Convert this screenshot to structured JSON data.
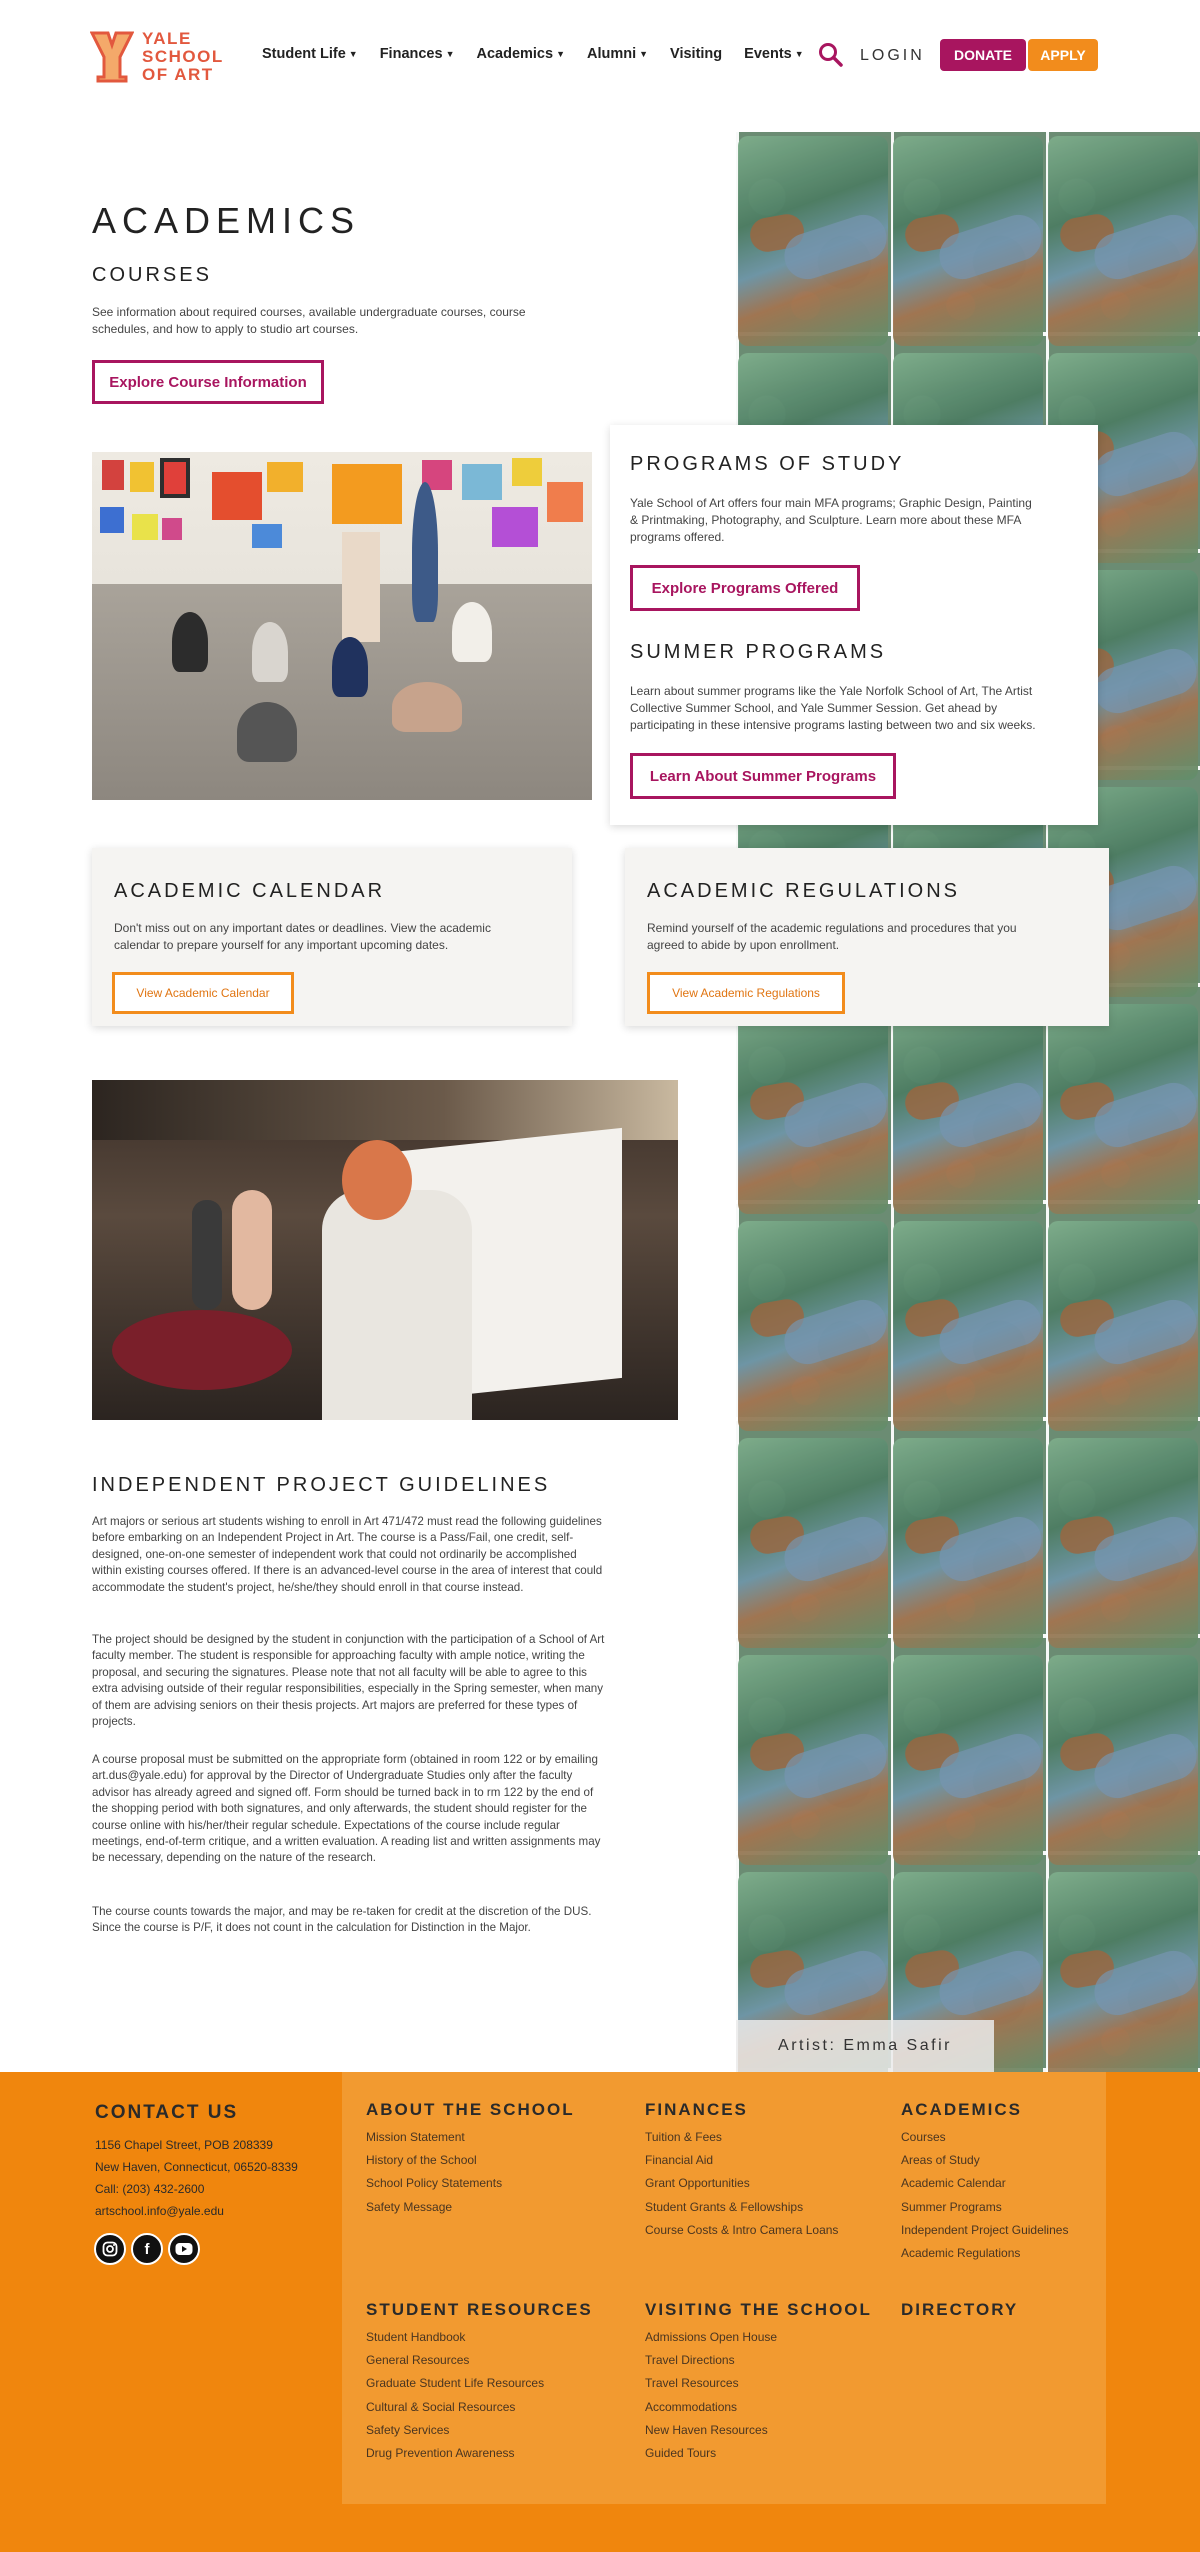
{
  "header": {
    "logo_text": [
      "YALE",
      "SCHOOL",
      "OF ART"
    ],
    "nav": [
      {
        "label": "Student Life",
        "dropdown": true
      },
      {
        "label": "Finances",
        "dropdown": true
      },
      {
        "label": "Academics",
        "dropdown": true
      },
      {
        "label": "Alumni",
        "dropdown": true
      },
      {
        "label": "Visiting",
        "dropdown": false
      },
      {
        "label": "Events",
        "dropdown": true
      }
    ],
    "login_label": "LOGIN",
    "donate_label": "DONATE",
    "apply_label": "APPLY"
  },
  "page": {
    "title": "ACADEMICS",
    "courses": {
      "heading": "COURSES",
      "text": "See information about required courses, available undergraduate courses, course schedules, and how to apply to studio art courses.",
      "button": "Explore Course Information"
    },
    "programs": {
      "heading": "PROGRAMS OF STUDY",
      "text": "Yale School of Art offers four main MFA programs; Graphic Design, Painting & Printmaking, Photography, and Sculpture. Learn more about these MFA programs offered.",
      "button": "Explore Programs Offered"
    },
    "summer": {
      "heading": "SUMMER PROGRAMS",
      "text": "Learn about summer programs like the Yale Norfolk School of Art, The Artist Collective Summer School, and Yale Summer Session. Get ahead by participating in these intensive programs lasting between two and six weeks.",
      "button": "Learn About Summer Programs"
    },
    "calendar": {
      "heading": "ACADEMIC CALENDAR",
      "text": "Don't miss out on any important dates or deadlines. View the academic calendar to prepare yourself for any important upcoming dates.",
      "button": "View Academic Calendar"
    },
    "regulations": {
      "heading": "ACADEMIC REGULATIONS",
      "text": "Remind yourself of the academic regulations and procedures that you agreed to abide by upon enrollment.",
      "button": "View Academic Regulations"
    },
    "ipg": {
      "heading": "INDEPENDENT PROJECT GUIDELINES",
      "paragraphs": [
        "Art majors or serious art students wishing to enroll in Art 471/472 must read the following guidelines before embarking on an Independent Project in Art. The course is a Pass/Fail, one credit, self-designed, one-on-one semester of independent work that could not ordinarily be accomplished within existing courses offered. If there is an advanced-level course in the area of interest that could accommodate the student's project, he/she/they should enroll in that course instead.",
        "The project should be designed by the student in conjunction with the participation of a School of Art faculty member. The student is responsible for approaching faculty with ample notice, writing the proposal, and securing the signatures. Please note that not all faculty will be able to agree to this extra advising outside of their regular responsibilities, especially in the Spring semester, when many of them are advising seniors on their thesis projects. Art majors are preferred for these types of projects.",
        "A course proposal must be submitted on the appropriate form (obtained in room 122 or by emailing art.dus@yale.edu) for approval by the Director of Undergraduate Studies only after the faculty advisor has already agreed and signed off. Form should be turned back in to rm 122 by the end of the shopping period with both signatures, and only afterwards, the student should register for the course online with his/her/their regular schedule. Expectations of the course include regular meetings, end-of-term critique, and a written evaluation. A reading list and written assignments may be necessary, depending on the nature of the research.",
        "The course counts towards the major, and may be re-taken for credit at the discretion of the DUS. Since the course is P/F, it does not count in the calculation for Distinction in the Major."
      ]
    },
    "artist_caption": "Artist: Emma Safir"
  },
  "footer": {
    "contact": {
      "heading": "CONTACT US",
      "address1": "1156 Chapel Street, POB 208339",
      "address2": "New Haven, Connecticut, 06520-8339",
      "phone": "Call: (203) 432-2600",
      "email": "artschool.info@yale.edu",
      "social": [
        "instagram-icon",
        "facebook-icon",
        "youtube-icon"
      ]
    },
    "about": {
      "heading": "ABOUT THE SCHOOL",
      "links": [
        "Mission Statement",
        "History of the School",
        "School Policy Statements",
        "Safety Message"
      ]
    },
    "finances": {
      "heading": "FINANCES",
      "links": [
        "Tuition & Fees",
        "Financial Aid",
        "Grant Opportunities",
        "Student Grants & Fellowships",
        "Course Costs & Intro Camera Loans"
      ]
    },
    "academics": {
      "heading": "ACADEMICS",
      "links": [
        "Courses",
        "Areas of Study",
        "Academic Calendar",
        "Summer Programs",
        "Independent Project Guidelines",
        "Academic Regulations"
      ]
    },
    "student_resources": {
      "heading": "STUDENT RESOURCES",
      "links": [
        "Student Handbook",
        "General Resources",
        "Graduate Student Life Resources",
        "Cultural & Social Resources",
        "Safety Services",
        "Drug Prevention Awareness"
      ]
    },
    "visiting": {
      "heading": "VISITING THE SCHOOL",
      "links": [
        "Admissions Open House",
        "Travel Directions",
        "Travel Resources",
        "Accommodations",
        "New Haven Resources",
        "Guided Tours"
      ]
    },
    "directory": {
      "heading": "DIRECTORY"
    }
  },
  "colors": {
    "brand_magenta": "#a8155f",
    "brand_orange": "#f28c1c",
    "footer_orange": "#f0860d",
    "logo_red": "#e2583e"
  }
}
